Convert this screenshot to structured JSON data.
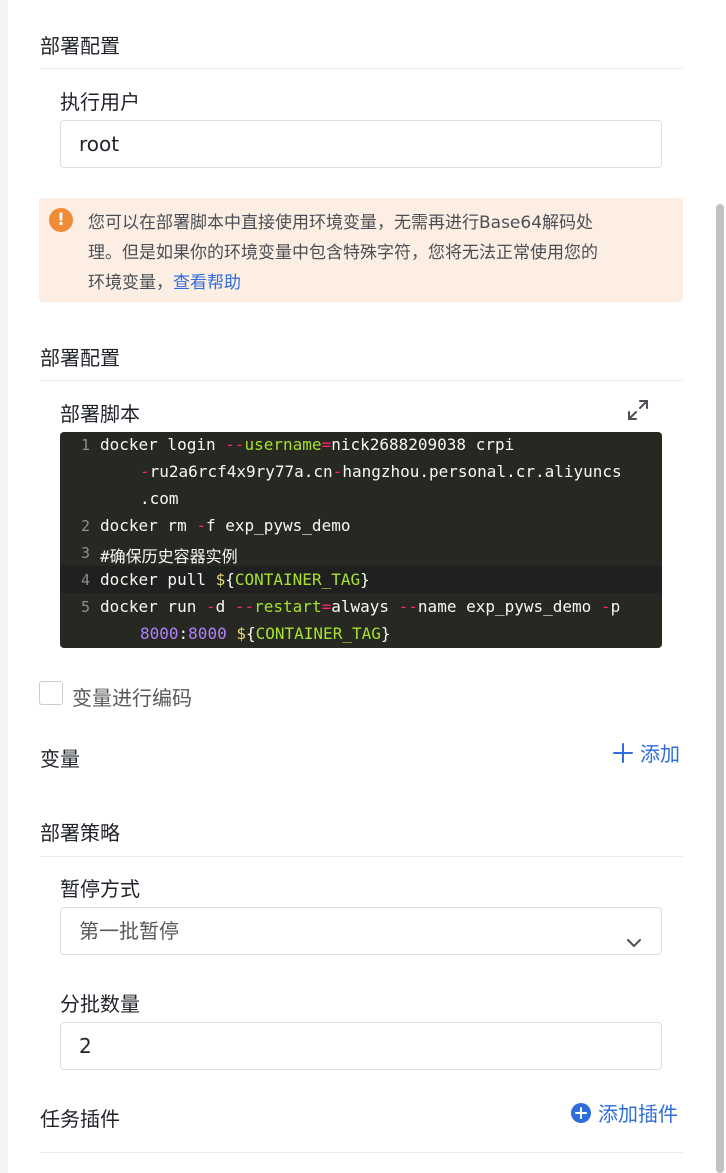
{
  "sections": {
    "deploy_config_1": "部署配置",
    "deploy_config_2": "部署配置",
    "strategy": "部署策略"
  },
  "exec_user": {
    "label": "执行用户",
    "value": "root"
  },
  "alert": {
    "line1": "您可以在部署脚本中直接使用环境变量，无需再进行Base64解码处",
    "line2": "理。但是如果你的环境变量中包含特殊字符，您将无法正常使用您的",
    "line3_text": "环境变量，",
    "link": "查看帮助",
    "color": "#f08c36"
  },
  "script": {
    "label": "部署脚本",
    "line_numbers": [
      "1",
      "2",
      "3",
      "4",
      "5"
    ],
    "lines": {
      "l1a_cmd": "docker login ",
      "l1a_opt": "--",
      "l1a_attr": "username",
      "l1a_eq": "=",
      "l1a_val": "nick2688209038 crpi",
      "l1b_dash": "-",
      "l1b_text1": "ru2a6rcf4x9ry77a.cn",
      "l1b_dash2": "-",
      "l1b_text2": "hangzhou.personal.cr.aliyuncs",
      "l1c": ".com",
      "l2_cmd": "docker rm ",
      "l2_opt": "-",
      "l2_rest": "f exp_pyws_demo",
      "l3_comment": "#确保历史容器实例",
      "l4_cmd": "docker pull ",
      "l4_dollar": "$",
      "l4_brace_open": "{",
      "l4_var": "CONTAINER_TAG",
      "l4_brace_close": "}",
      "l5_cmd": "docker run ",
      "l5_opt1": "-",
      "l5_d": "d ",
      "l5_opt2": "--",
      "l5_restart": "restart",
      "l5_eq": "=",
      "l5_always": "always ",
      "l5_opt3": "--",
      "l5_name": "name exp_pyws_demo ",
      "l5_opt4": "-",
      "l5_p": "p",
      "l5b_port1": "8000",
      "l5b_colon": ":",
      "l5b_port2": "8000",
      "l5b_space": " ",
      "l5b_dollar": "$",
      "l5b_brace_open": "{",
      "l5b_var": "CONTAINER_TAG",
      "l5b_brace_close": "}"
    }
  },
  "encode_checkbox": {
    "label": "变量进行编码",
    "checked": false
  },
  "variables": {
    "label": "变量",
    "add_label": "添加"
  },
  "pause_mode": {
    "label": "暂停方式",
    "value": "第一批暂停"
  },
  "batch_count": {
    "label": "分批数量",
    "value": "2"
  },
  "plugins": {
    "label": "任务插件",
    "add_label": "添加插件"
  }
}
